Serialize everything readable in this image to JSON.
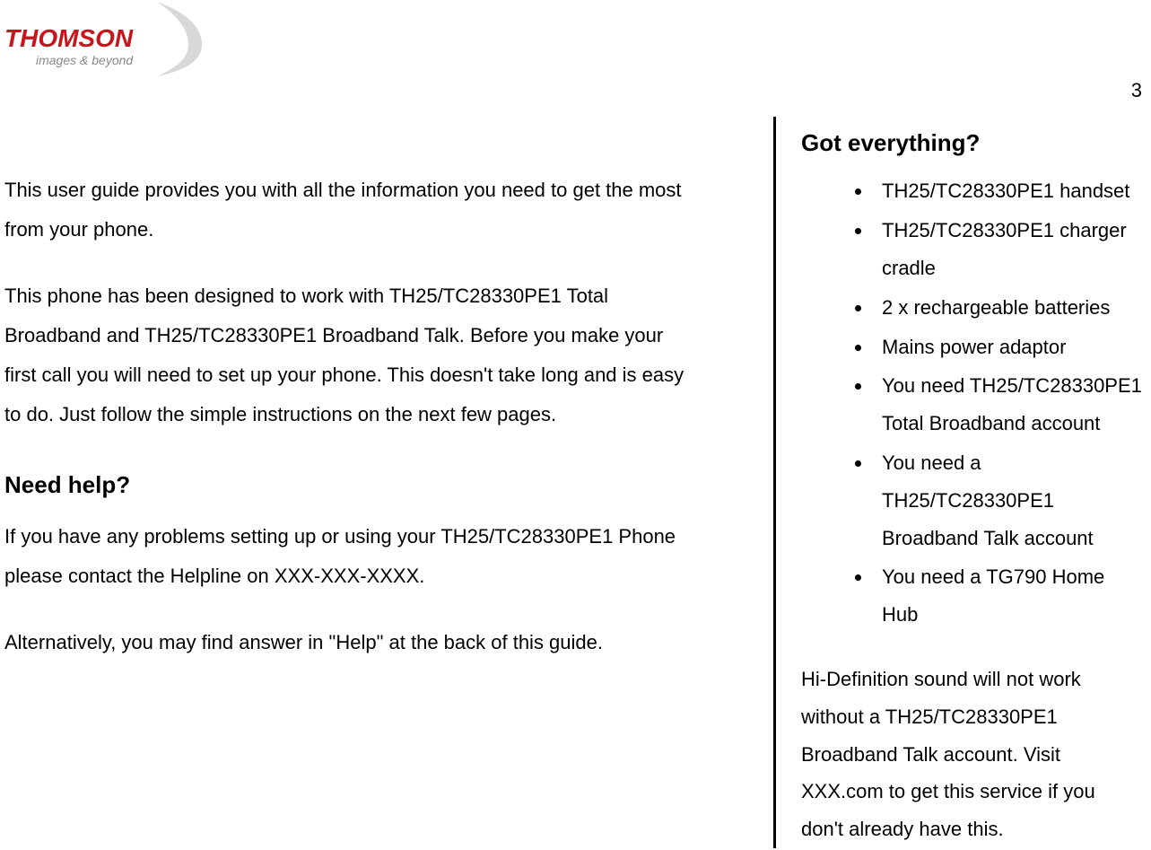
{
  "logo": {
    "brand": "THOMSON",
    "tagline": "images & beyond"
  },
  "page_number": "3",
  "main": {
    "intro_p1": "This user guide provides you with all the information you need to get the most from your phone.",
    "intro_p2": "This phone has been designed to work with TH25/TC28330PE1 Total Broadband and TH25/TC28330PE1 Broadband Talk.  Before you make your first call you will need to set up your phone.  This doesn't take long and is easy to do.  Just follow the simple instructions on the next few pages.",
    "need_help_heading": "Need help?",
    "need_help_p1": "If you have any problems setting up or using your TH25/TC28330PE1 Phone please contact the Helpline on XXX-XXX-XXXX.",
    "need_help_p2": "Alternatively, you may find answer in \"Help\" at the back of this guide."
  },
  "sidebar": {
    "heading": "Got everything?",
    "items": [
      "TH25/TC28330PE1 handset",
      "TH25/TC28330PE1 charger cradle",
      "2 x rechargeable batteries",
      "Mains power adaptor",
      "You need TH25/TC28330PE1 Total Broadband account",
      "You need a TH25/TC28330PE1 Broadband Talk account",
      "You need a TG790 Home Hub"
    ],
    "note": "Hi-Definition sound will not work without a TH25/TC28330PE1 Broadband Talk account.  Visit XXX.com to get this service if you don't already have this."
  }
}
